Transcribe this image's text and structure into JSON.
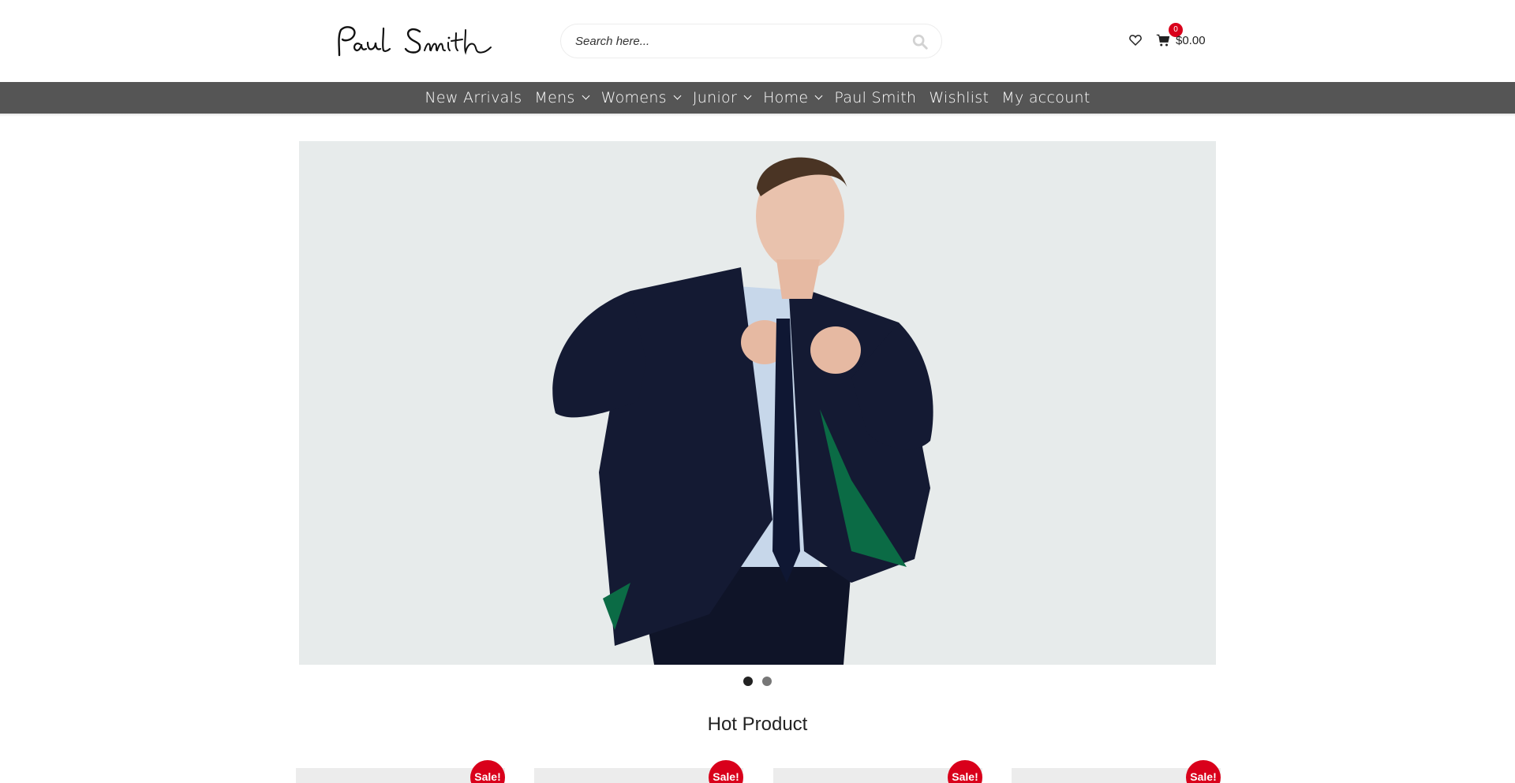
{
  "brand": {
    "name": "Paul Smith"
  },
  "search": {
    "placeholder": "Search here..."
  },
  "header": {
    "cart_count": "0",
    "cart_total": "$0.00"
  },
  "nav": {
    "items": [
      {
        "label": "New Arrivals",
        "has_dropdown": false
      },
      {
        "label": "Mens",
        "has_dropdown": true
      },
      {
        "label": "Womens",
        "has_dropdown": true
      },
      {
        "label": "Junior",
        "has_dropdown": true
      },
      {
        "label": "Home",
        "has_dropdown": true
      },
      {
        "label": "Paul Smith",
        "has_dropdown": false
      },
      {
        "label": "Wishlist",
        "has_dropdown": false
      },
      {
        "label": "My account",
        "has_dropdown": false
      }
    ]
  },
  "slider": {
    "slide_count": 2,
    "active_index": 0
  },
  "section": {
    "title": "Hot Product"
  },
  "products": [
    {
      "badge": "Sale!"
    },
    {
      "badge": "Sale!"
    },
    {
      "badge": "Sale!"
    },
    {
      "badge": "Sale!"
    }
  ],
  "colors": {
    "nav_bg": "#555555",
    "accent": "#d9001b",
    "hero_bg": "#e7ebeb"
  },
  "icons": [
    "search-icon",
    "heart-icon",
    "cart-icon"
  ]
}
